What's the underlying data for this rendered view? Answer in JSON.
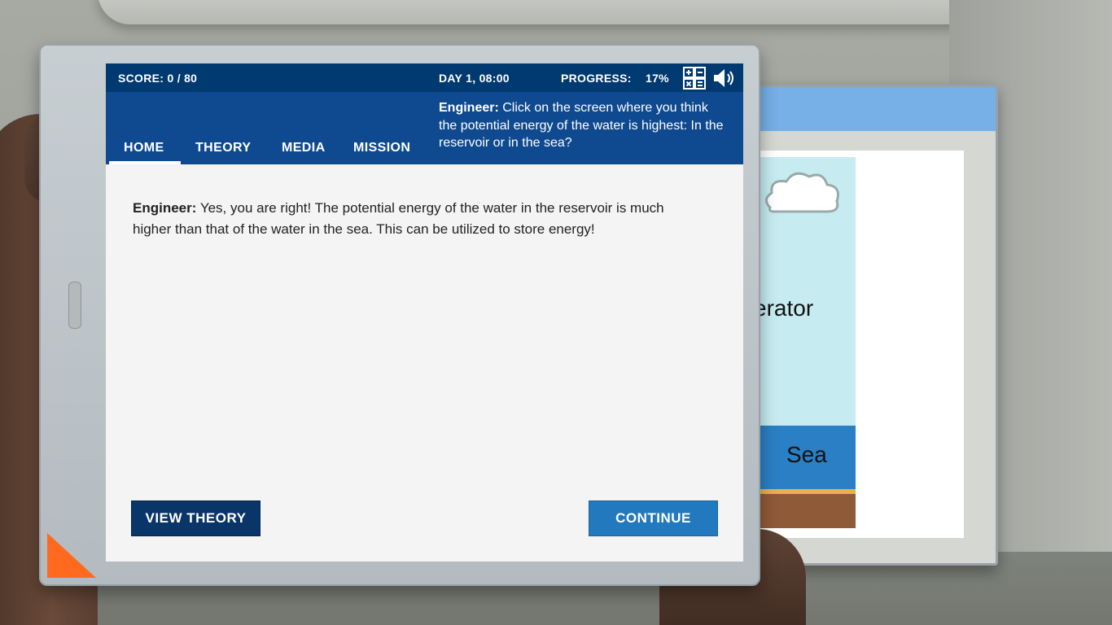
{
  "status": {
    "score": "SCORE: 0 / 80",
    "day_time": "DAY 1, 08:00",
    "progress_label": "PROGRESS:",
    "progress_value": "17%",
    "icons": [
      "calculator-icon",
      "speaker-icon"
    ]
  },
  "nav": {
    "tabs": [
      {
        "label": "HOME",
        "active": true
      },
      {
        "label": "THEORY",
        "active": false
      },
      {
        "label": "MEDIA",
        "active": false
      },
      {
        "label": "MISSION",
        "active": false
      }
    ]
  },
  "hint": {
    "speaker": "Engineer:",
    "text": " Click on the screen where you think the potential energy of the water is highest: In the reservoir or in the sea?"
  },
  "message": {
    "speaker": "Engineer:",
    "text": " Yes, you are right! The potential energy of the water in the reservoir is much higher than that of the water in the sea. This can be utilized to store energy!"
  },
  "buttons": {
    "view_theory": "VIEW THEORY",
    "continue": "CONTINUE"
  },
  "background_monitor": {
    "partial_label": "erator",
    "sea_label": "Sea"
  },
  "colors": {
    "status_bar": "#003a70",
    "nav_bar": "#0f4a90",
    "continue_button": "#2379bd",
    "view_theory_button": "#0a3568",
    "tablet_accent": "#ff6a1f"
  }
}
